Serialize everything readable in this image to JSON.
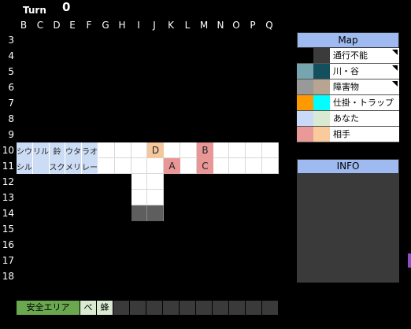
{
  "header": {
    "turn_label": "Turn",
    "turn_value": "0"
  },
  "columns": [
    "B",
    "C",
    "D",
    "E",
    "F",
    "G",
    "H",
    "I",
    "J",
    "K",
    "L",
    "M",
    "N",
    "O",
    "P",
    "Q"
  ],
  "rows": [
    "3",
    "4",
    "5",
    "6",
    "7",
    "8",
    "9",
    "10",
    "11",
    "12",
    "13",
    "14",
    "15",
    "16",
    "17",
    "18"
  ],
  "board": {
    "row10": [
      "シウ",
      "リル",
      "鈴",
      "ウタ",
      "ラオ",
      "",
      "",
      "",
      "D",
      "",
      "",
      "B",
      "",
      "",
      "",
      ""
    ],
    "row11": [
      "シル",
      "",
      "スク",
      "メリ",
      "レー",
      "",
      "",
      "",
      "",
      "A",
      "",
      "C",
      "",
      "",
      "",
      ""
    ]
  },
  "map_legend": {
    "title": "Map",
    "items": [
      {
        "label": "通行不能",
        "color_a": "#000000",
        "color_b": "#3b3b3b",
        "flag": true
      },
      {
        "label": "川・谷",
        "color_a": "#76a5af",
        "color_b": "#134f5c",
        "flag": true
      },
      {
        "label": "障害物",
        "color_a": "#999999",
        "color_b": "#b7a591",
        "flag": true
      },
      {
        "label": "仕掛・トラップ",
        "color_a": "#ff9900",
        "color_b": "#00ffff",
        "flag": false
      },
      {
        "label": "あなた",
        "color_a": "#c9daf8",
        "color_b": "#d9ead3",
        "flag": false
      },
      {
        "label": "相手",
        "color_a": "#ea9999",
        "color_b": "#f9cb9c",
        "flag": false
      }
    ]
  },
  "info": {
    "title": "INFO"
  },
  "safe_area": {
    "label": "安全エリア",
    "item1": "べ",
    "item2": "蜂"
  },
  "colors": {
    "you": "#ccdcf4",
    "opponent_a": "#e89696",
    "opponent_b": "#f5c79f",
    "blocked": "#5e5e5e",
    "safe_green": "#6aa84f"
  }
}
